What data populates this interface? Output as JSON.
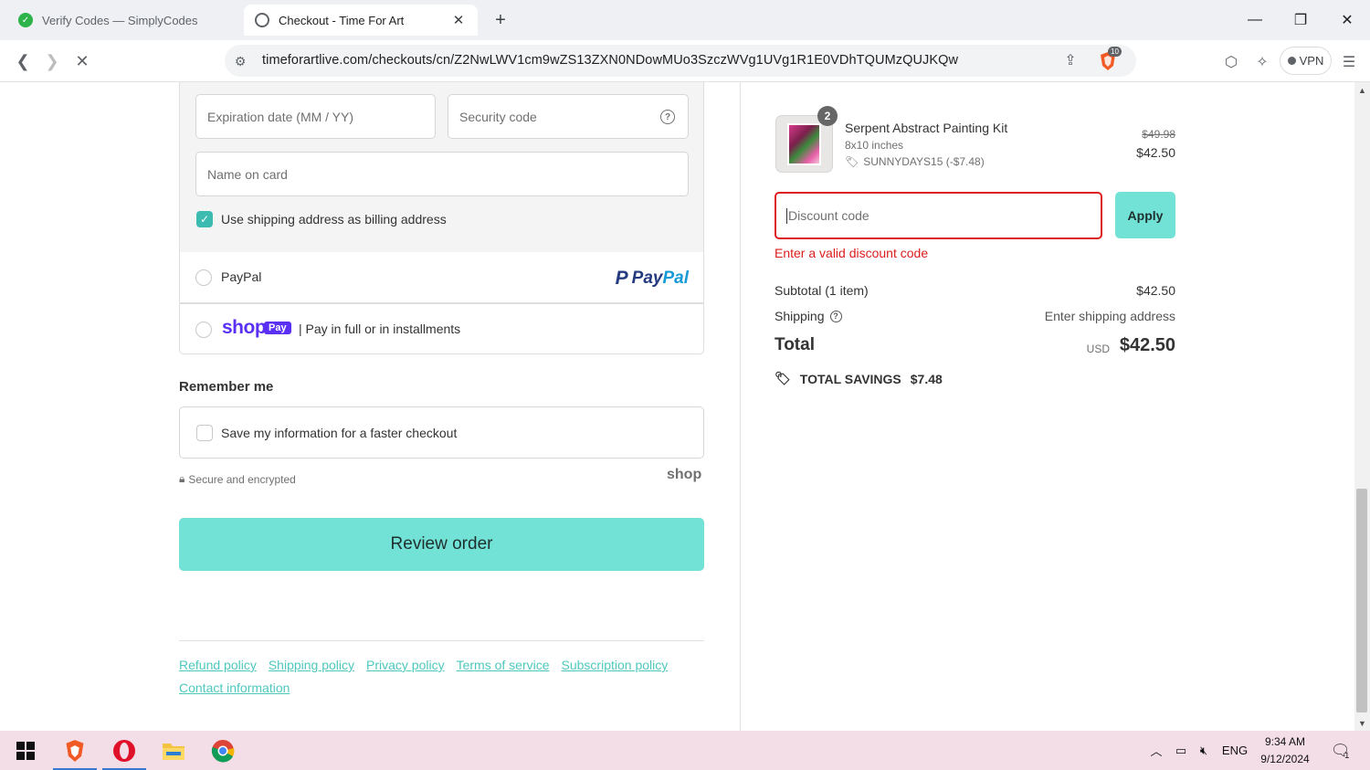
{
  "browser": {
    "tabs": [
      {
        "title": "Verify Codes — SimplyCodes",
        "active": false
      },
      {
        "title": "Checkout - Time For Art",
        "active": true
      }
    ],
    "url": "timeforartlive.com/checkouts/cn/Z2NwLWV1cm9wZS13ZXN0NDowMUo3SzczWVg1UVg1R1E0VDhTQUMzQUJKQw",
    "shield_badge": "10",
    "vpn_label": "VPN"
  },
  "payment": {
    "expiration_placeholder": "Expiration date (MM / YY)",
    "security_placeholder": "Security code",
    "name_placeholder": "Name on card",
    "billing_same_label": "Use shipping address as billing address",
    "paypal_label": "PayPal",
    "paypal_logo_a": "Pay",
    "paypal_logo_b": "Pal",
    "shoppay_word": "shop",
    "shoppay_pill": "Pay",
    "shoppay_label": "| Pay in full or in installments"
  },
  "remember": {
    "title": "Remember me",
    "save_label": "Save my information for a faster checkout",
    "secure_label": "Secure and encrypted",
    "shop_brand": "shop"
  },
  "review_button": "Review order",
  "policies": [
    "Refund policy",
    "Shipping policy",
    "Privacy policy",
    "Terms of service",
    "Subscription policy",
    "Contact information"
  ],
  "summary": {
    "quantity": "2",
    "product_name": "Serpent Abstract Painting Kit",
    "variant": "8x10 inches",
    "discount_line": "SUNNYDAYS15 (-$7.48)",
    "price_original": "$49.98",
    "price_final": "$42.50",
    "discount_placeholder": "Discount code",
    "apply_label": "Apply",
    "error_text": "Enter a valid discount code",
    "subtotal_label": "Subtotal (1 item)",
    "subtotal_value": "$42.50",
    "shipping_label": "Shipping",
    "shipping_value": "Enter shipping address",
    "total_label": "Total",
    "total_currency": "USD",
    "total_value": "$42.50",
    "savings_label": "TOTAL SAVINGS",
    "savings_value": "$7.48"
  },
  "taskbar": {
    "lang": "ENG",
    "time": "9:34 AM",
    "date": "9/12/2024",
    "notification_count": "1"
  },
  "colors": {
    "accent": "#72e2d7",
    "error": "#dd1d1d",
    "link": "#4ec8bd",
    "shoppay": "#5a31f4"
  }
}
